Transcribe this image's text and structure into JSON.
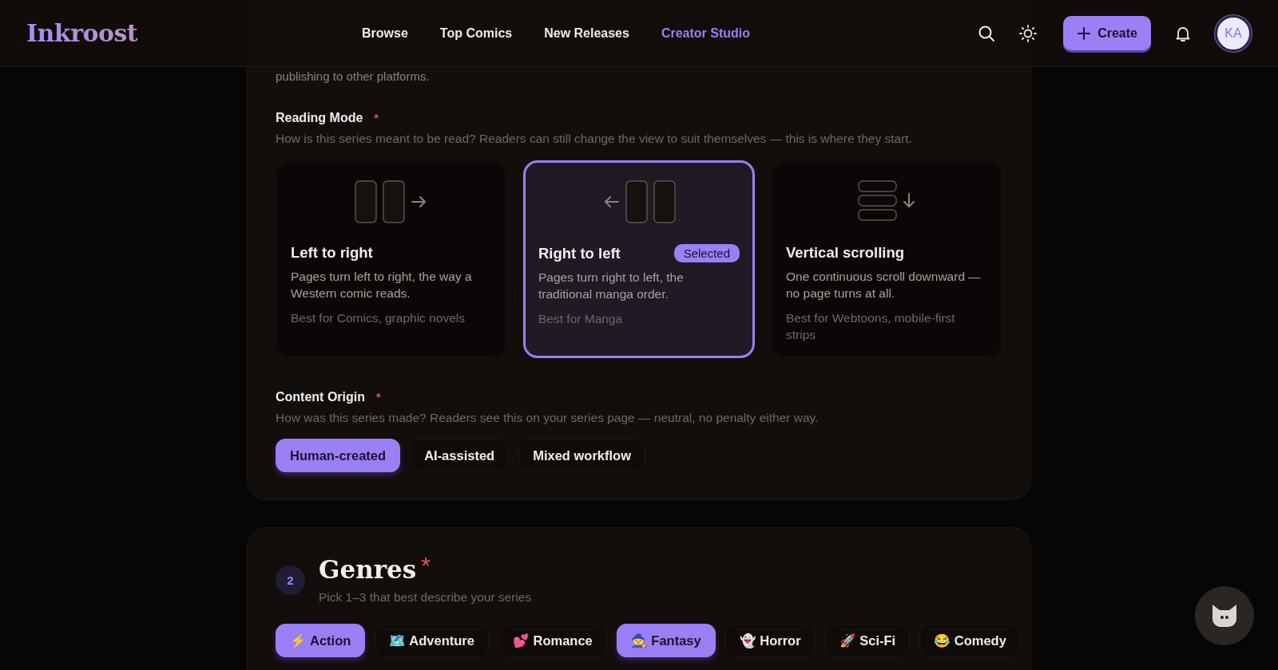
{
  "header": {
    "logo": "Inkroost",
    "nav": [
      {
        "label": "Browse",
        "selected": false
      },
      {
        "label": "Top Comics",
        "selected": false
      },
      {
        "label": "New Releases",
        "selected": false
      },
      {
        "label": "Creator Studio",
        "selected": true
      }
    ],
    "create_button": "Create",
    "avatar": "KA"
  },
  "details_section": {
    "cut_text": "publishing to other platforms.",
    "reading_mode": {
      "label": "Reading Mode",
      "required": "*",
      "hint": "How is this series meant to be read? Readers can still change the view to suit themselves — this is where they start.",
      "options": [
        {
          "kind": "ltr",
          "title": "Left to right",
          "description": "Pages turn left to right, the way a Western comic reads.",
          "best_for": "Best for Comics, graphic novels",
          "selected": false
        },
        {
          "kind": "rtl",
          "title": "Right to left",
          "description": "Pages turn right to left, the traditional manga order.",
          "best_for": "Best for Manga",
          "selected": true,
          "badge": "Selected"
        },
        {
          "kind": "vertical",
          "title": "Vertical scrolling",
          "description": "One continuous scroll downward — no page turns at all.",
          "best_for": "Best for Webtoons, mobile-first strips",
          "selected": false
        }
      ]
    },
    "content_origin": {
      "label": "Content Origin",
      "required": "*",
      "hint": "How was this series made? Readers see this on your series page — neutral, no penalty either way.",
      "options": [
        {
          "label": "Human-created",
          "selected": true
        },
        {
          "label": "AI-assisted",
          "selected": false
        },
        {
          "label": "Mixed workflow",
          "selected": false
        }
      ]
    }
  },
  "genres_section": {
    "step": "2",
    "title": "Genres",
    "required": "*",
    "subtitle": "Pick 1–3 that best describe your series",
    "genres": [
      {
        "label": "⚡ Action",
        "selected": true
      },
      {
        "label": "🗺️ Adventure",
        "selected": false
      },
      {
        "label": "💕 Romance",
        "selected": false
      },
      {
        "label": "🧙 Fantasy",
        "selected": true
      },
      {
        "label": "👻 Horror",
        "selected": false
      },
      {
        "label": "🚀 Sci-Fi",
        "selected": false
      },
      {
        "label": "😂 Comedy",
        "selected": false
      }
    ]
  }
}
